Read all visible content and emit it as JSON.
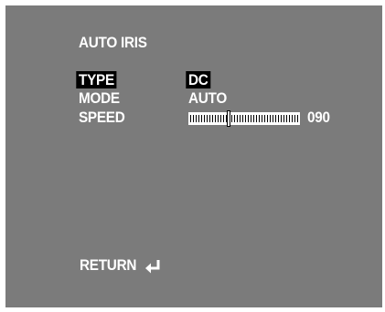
{
  "title": "AUTO IRIS",
  "rows": {
    "type": {
      "label": "TYPE",
      "value": "DC"
    },
    "mode": {
      "label": "MODE",
      "value": "AUTO"
    },
    "speed": {
      "label": "SPEED",
      "value": "090",
      "level": 0.36
    }
  },
  "return": {
    "label": "RETURN",
    "icon": "enter-return-icon"
  },
  "colors": {
    "background": "#7b7b7b",
    "text": "#ffffff",
    "highlight": "#000000"
  }
}
